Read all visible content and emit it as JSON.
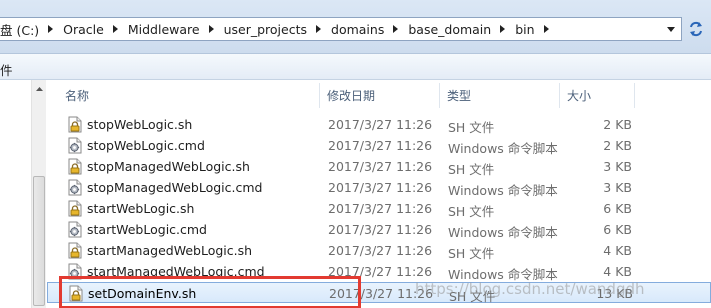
{
  "address_bar": {
    "crumbs": [
      "盘 (C:)",
      "Oracle",
      "Middleware",
      "user_projects",
      "domains",
      "base_domain",
      "bin"
    ]
  },
  "toolbar": {
    "fragment": "件"
  },
  "columns": {
    "name": "名称",
    "date": "修改日期",
    "type": "类型",
    "size": "大小"
  },
  "files": [
    {
      "name": "stopWebLogic.sh",
      "date": "2017/3/27 11:26",
      "type": "SH 文件",
      "size": "2 KB",
      "icon": "sh-file-icon"
    },
    {
      "name": "stopWebLogic.cmd",
      "date": "2017/3/27 11:26",
      "type": "Windows 命令脚本",
      "size": "2 KB",
      "icon": "cmd-file-icon"
    },
    {
      "name": "stopManagedWebLogic.sh",
      "date": "2017/3/27 11:26",
      "type": "SH 文件",
      "size": "3 KB",
      "icon": "sh-file-icon"
    },
    {
      "name": "stopManagedWebLogic.cmd",
      "date": "2017/3/27 11:26",
      "type": "Windows 命令脚本",
      "size": "3 KB",
      "icon": "cmd-file-icon"
    },
    {
      "name": "startWebLogic.sh",
      "date": "2017/3/27 11:26",
      "type": "SH 文件",
      "size": "6 KB",
      "icon": "sh-file-icon"
    },
    {
      "name": "startWebLogic.cmd",
      "date": "2017/3/27 11:26",
      "type": "Windows 命令脚本",
      "size": "6 KB",
      "icon": "cmd-file-icon"
    },
    {
      "name": "startManagedWebLogic.sh",
      "date": "2017/3/27 11:26",
      "type": "SH 文件",
      "size": "4 KB",
      "icon": "sh-file-icon"
    },
    {
      "name": "startManagedWebLogic.cmd",
      "date": "2017/3/27 11:26",
      "type": "Windows 命令脚本",
      "size": "4 KB",
      "icon": "cmd-file-icon"
    },
    {
      "name": "setDomainEnv.sh",
      "date": "2017/3/27 11:26",
      "type": "SH 文件",
      "size": "13 KB",
      "icon": "sh-file-icon",
      "selected": true
    }
  ],
  "watermark": "https://blog.csdn.net/wandgdh",
  "colors": {
    "highlight_box": "#e23a31",
    "selection_border": "#84acdd",
    "header_text": "#4c607a"
  }
}
